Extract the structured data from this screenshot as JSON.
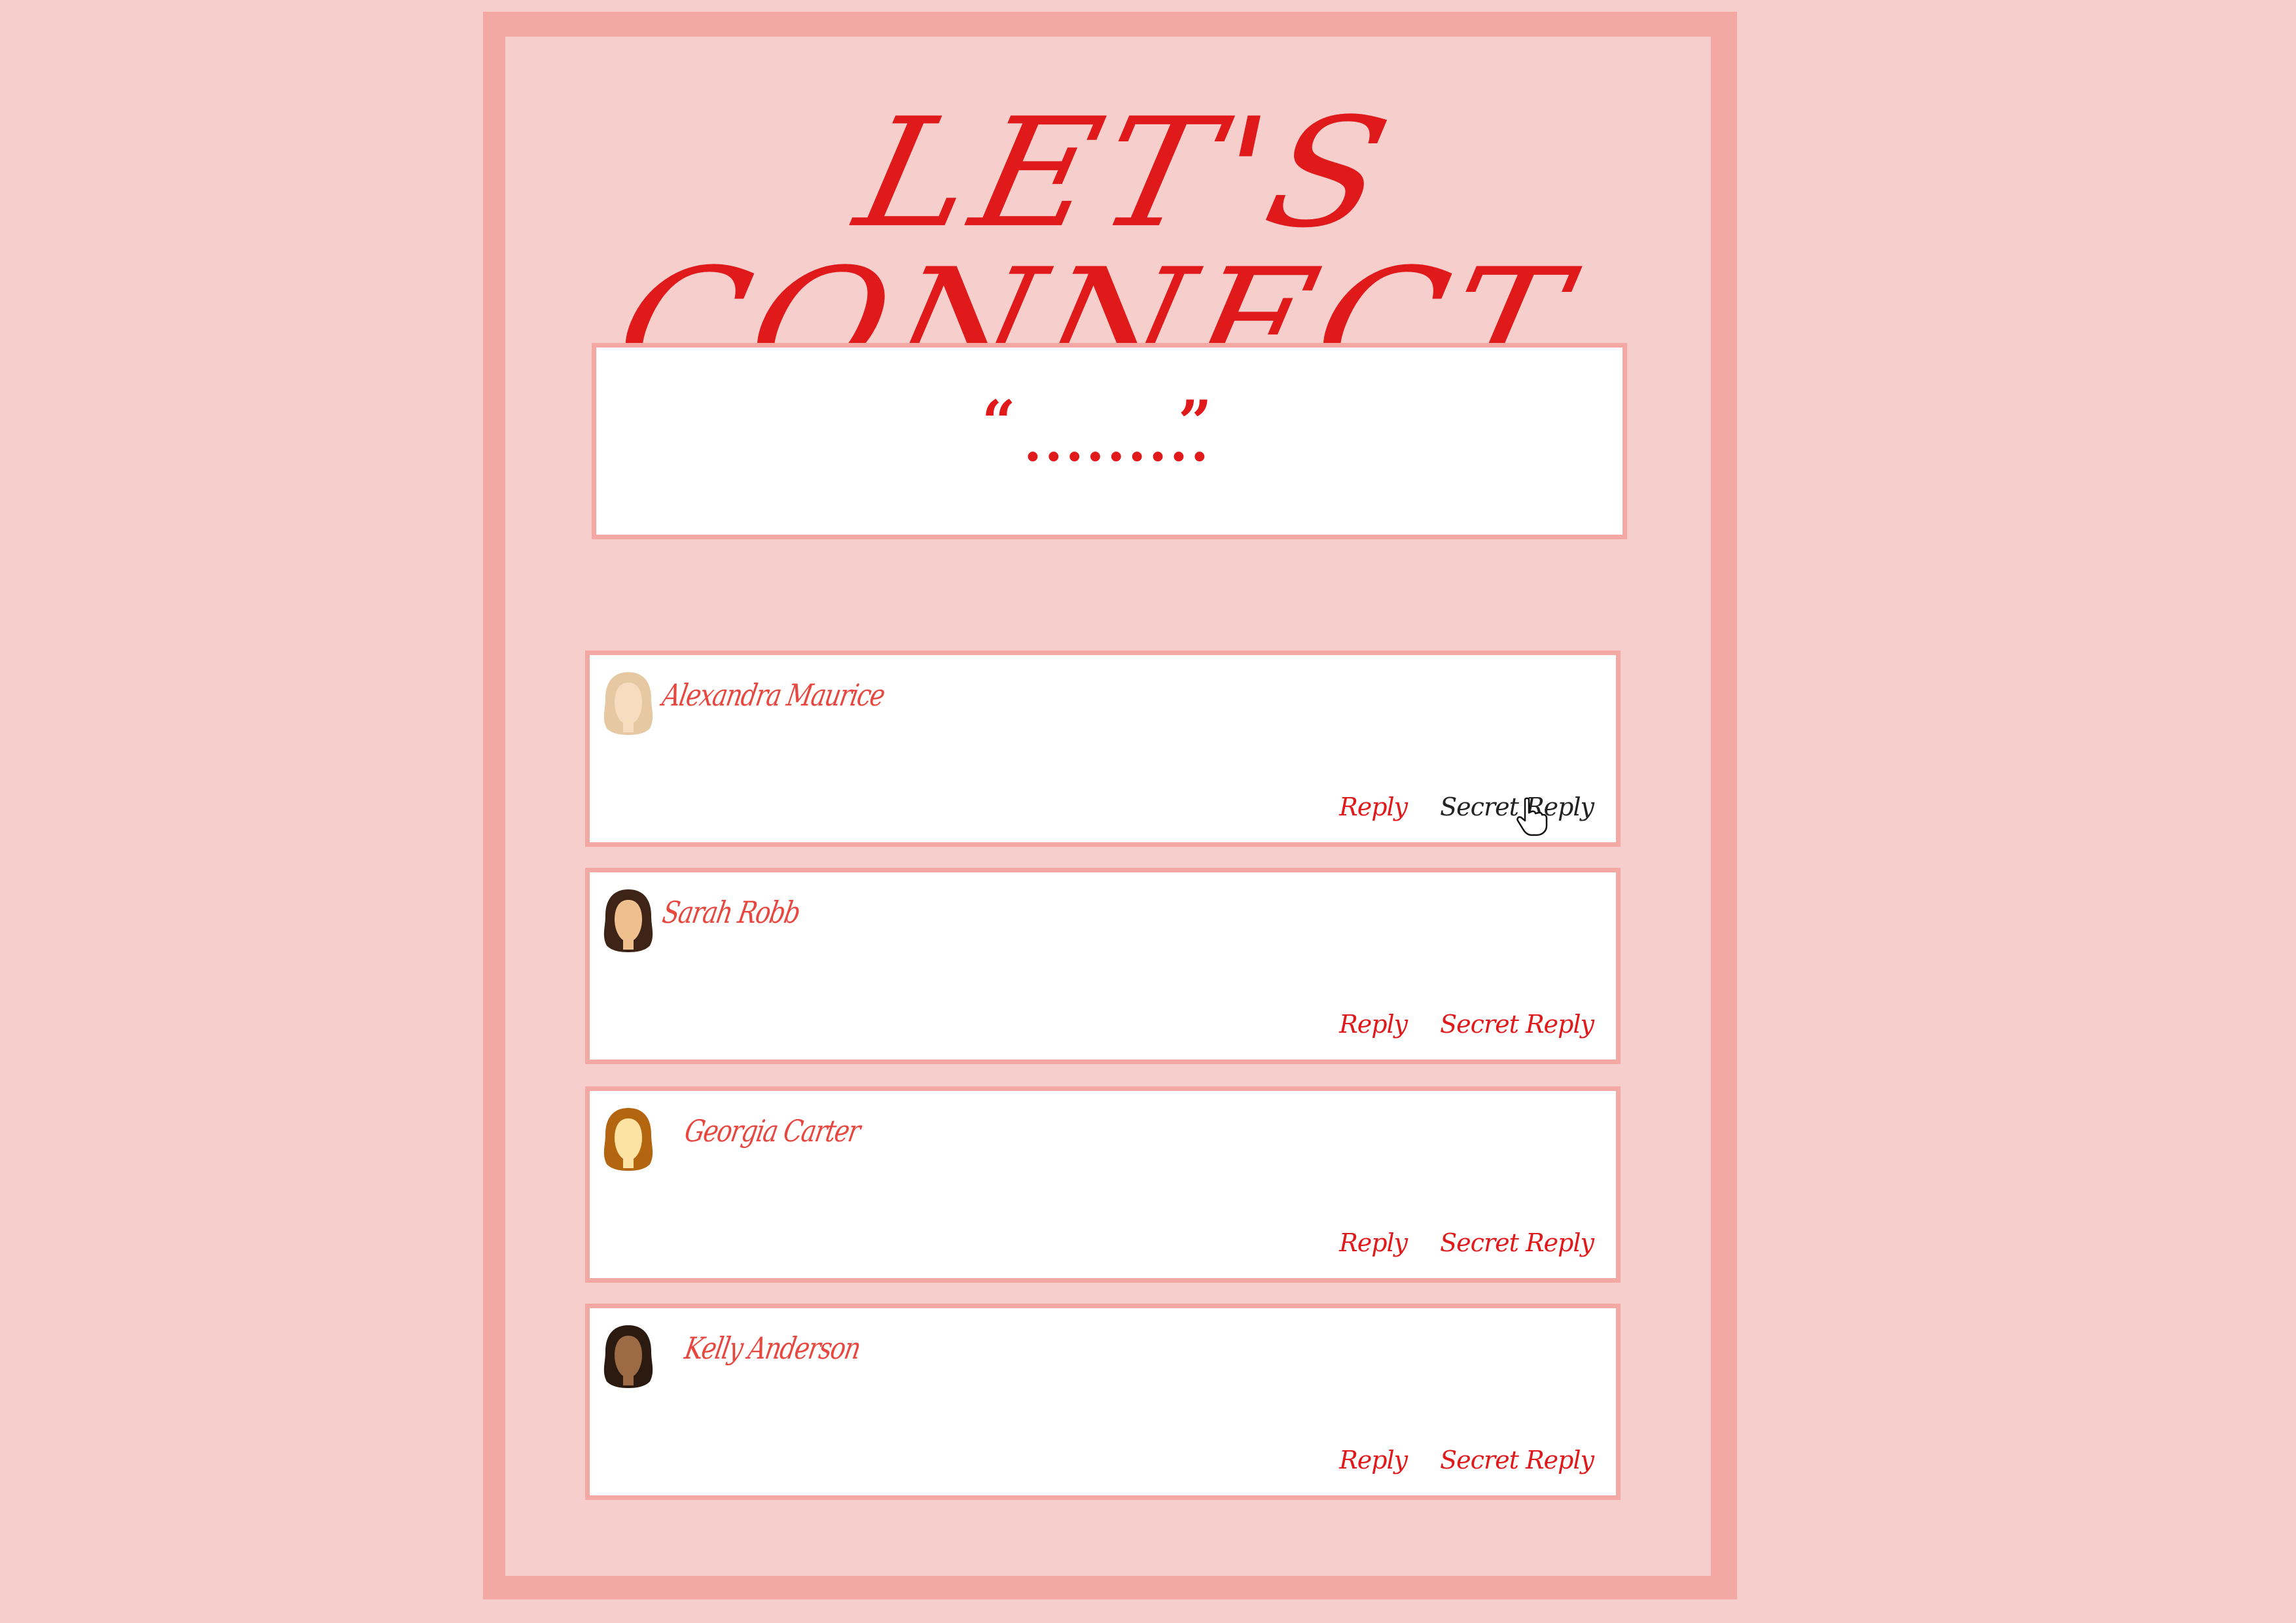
{
  "page": {
    "title": "LET'S CONNECT",
    "quote": {
      "open": "“",
      "dots": ".........",
      "close": "”"
    }
  },
  "comments": [
    {
      "name": "Alexandra Maurice",
      "reply_label": "Reply",
      "secret_reply_label": "Secret Reply",
      "hair": "#e6c9a2",
      "skin": "#f7dcc0"
    },
    {
      "name": "Sarah Robb",
      "reply_label": "Reply",
      "secret_reply_label": "Secret Reply",
      "hair": "#3e2417",
      "skin": "#efbf8e"
    },
    {
      "name": "Georgia Carter",
      "reply_label": "Reply",
      "secret_reply_label": "Secret Reply",
      "hair": "#b3650f",
      "skin": "#fde3a3"
    },
    {
      "name": "Kelly Anderson",
      "reply_label": "Reply",
      "secret_reply_label": "Secret Reply",
      "hair": "#2a1a10",
      "skin": "#9c6a45"
    }
  ],
  "colors": {
    "accent": "#e0191b",
    "frame": "#f3a8a3",
    "background": "#f6cfcc",
    "name": "#e8473f"
  },
  "icons": [
    "avatar-icon",
    "pointer-cursor-icon"
  ]
}
